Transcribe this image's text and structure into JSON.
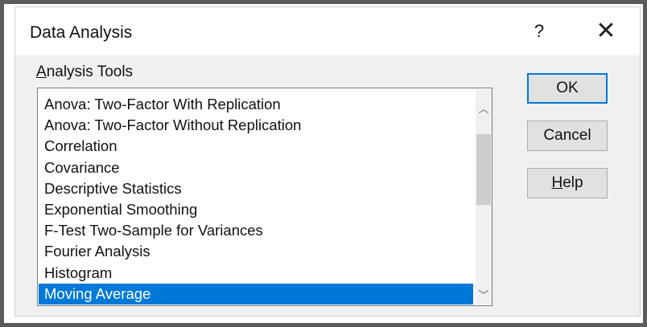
{
  "window": {
    "title": "Data Analysis",
    "help_glyph": "?",
    "close_glyph": "✕"
  },
  "analysis_tools": {
    "label_accel": "A",
    "label_rest": "nalysis Tools",
    "items": [
      "Anova: Two-Factor With Replication",
      "Anova: Two-Factor Without Replication",
      "Correlation",
      "Covariance",
      "Descriptive Statistics",
      "Exponential Smoothing",
      "F-Test Two-Sample for Variances",
      "Fourier Analysis",
      "Histogram",
      "Moving Average"
    ],
    "selected": "Moving Average"
  },
  "scrollbar": {
    "up_glyph": "︿",
    "down_glyph": "﹀"
  },
  "buttons": {
    "ok": "OK",
    "cancel": "Cancel",
    "help_accel": "H",
    "help_rest": "elp"
  }
}
